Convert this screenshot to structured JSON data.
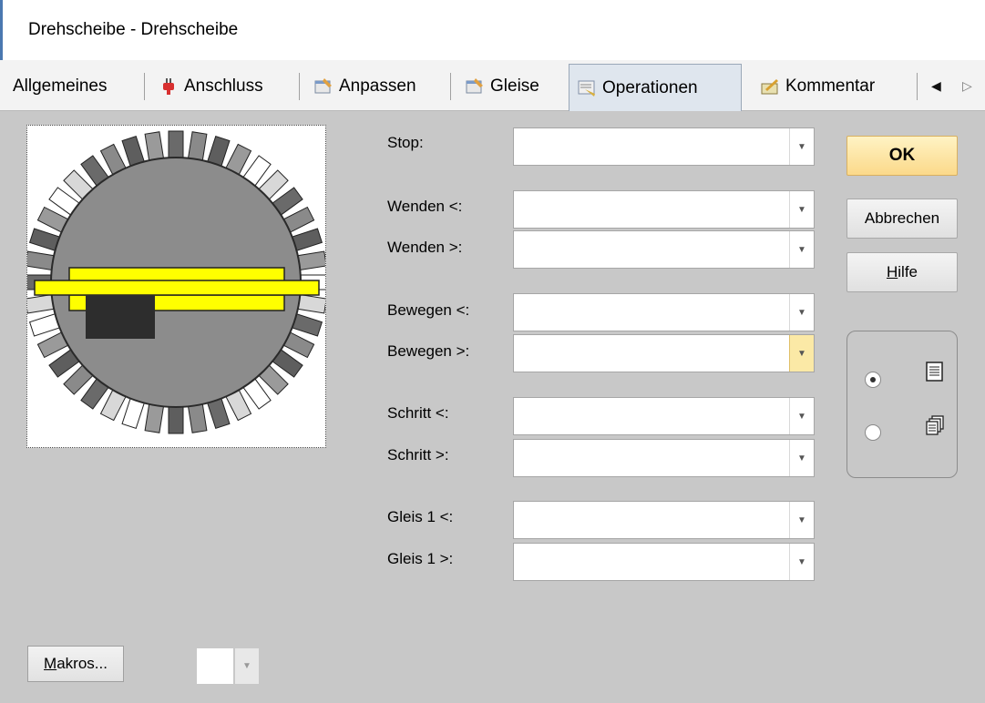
{
  "window": {
    "title": "Drehscheibe - Drehscheibe"
  },
  "tabs": [
    {
      "label": "Allgemeines",
      "icon": "none"
    },
    {
      "label": "Anschluss",
      "icon": "plug-icon"
    },
    {
      "label": "Anpassen",
      "icon": "customize-icon"
    },
    {
      "label": "Gleise",
      "icon": "tracks-icon"
    },
    {
      "label": "Operationen",
      "icon": "operations-icon",
      "active": true
    },
    {
      "label": "Kommentar",
      "icon": "comment-icon"
    }
  ],
  "fields": [
    {
      "label": "Stop:",
      "value": ""
    },
    {
      "label": "Wenden <:",
      "value": ""
    },
    {
      "label": "Wenden >:",
      "value": ""
    },
    {
      "label": "Bewegen <:",
      "value": ""
    },
    {
      "label": "Bewegen >:",
      "value": ""
    },
    {
      "label": "Schritt <:",
      "value": ""
    },
    {
      "label": "Schritt >:",
      "value": ""
    },
    {
      "label": "Gleis 1 <:",
      "value": ""
    },
    {
      "label": "Gleis 1 >:",
      "value": ""
    }
  ],
  "buttons": {
    "ok": "OK",
    "cancel": "Abbrechen",
    "help_prefix": "H",
    "help_rest": "ilfe",
    "macros_prefix": "M",
    "macros_rest": "akros..."
  },
  "view_mode": {
    "selected": "list"
  },
  "colors": {
    "ok_button": "#fbd98a",
    "bridge": "#ffff00",
    "highlight_arrow": "#fbe9a6"
  }
}
